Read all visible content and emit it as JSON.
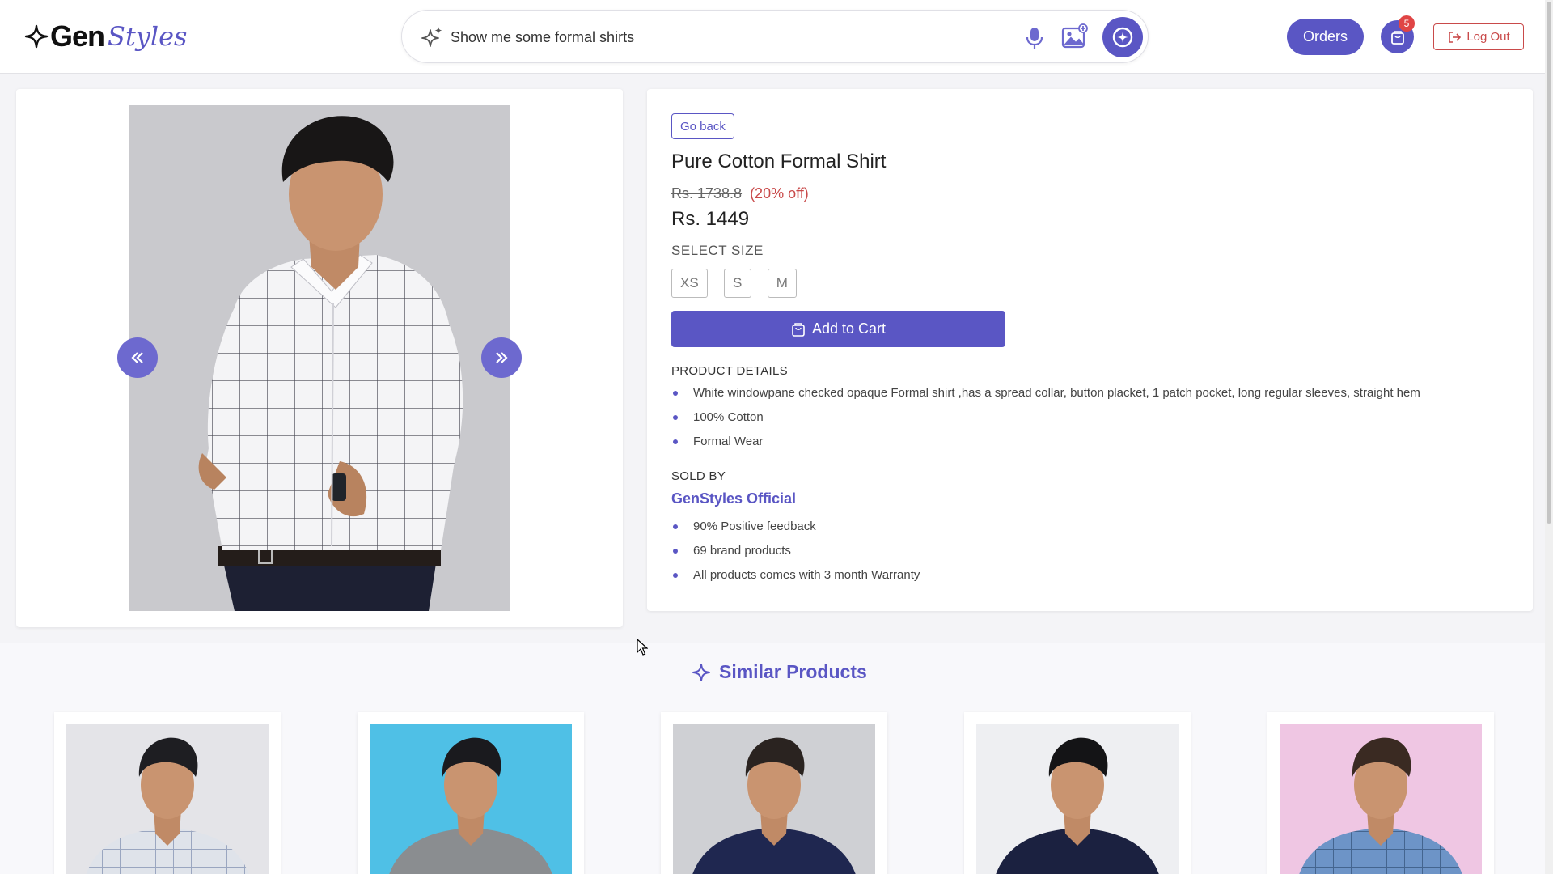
{
  "header": {
    "logo": {
      "gen": "Gen",
      "styles": "Styles"
    },
    "search": {
      "value": "Show me some formal shirts"
    },
    "orders_label": "Orders",
    "cart_count": "5",
    "logout_label": "Log Out"
  },
  "product": {
    "go_back_label": "Go back",
    "title": "Pure Cotton Formal Shirt",
    "original_price": "Rs. 1738.8",
    "discount": "(20% off)",
    "price": "Rs. 1449",
    "select_size_label": "SELECT SIZE",
    "sizes": [
      "XS",
      "S",
      "M"
    ],
    "add_to_cart_label": "Add to Cart",
    "details_label": "PRODUCT DETAILS",
    "details": [
      "White windowpane checked opaque Formal shirt ,has a spread collar, button placket, 1 patch pocket, long regular sleeves, straight hem",
      "100% Cotton",
      "Formal Wear"
    ],
    "sold_by_label": "SOLD BY",
    "seller": "GenStyles Official",
    "seller_points": [
      "90% Positive feedback",
      "69 brand products",
      "All products comes with 3 month Warranty"
    ]
  },
  "similar": {
    "title": "Similar Products",
    "items": [
      {
        "bg": "#e4e4e8",
        "shirt": "#dfe3ea",
        "check": "#9aa6c0",
        "hair": "#1e1e22"
      },
      {
        "bg": "#4fc0e6",
        "shirt": "#8a8d90",
        "check": "",
        "hair": "#1a1a1e"
      },
      {
        "bg": "#cfd0d4",
        "shirt": "#1f2750",
        "check": "",
        "hair": "#2a2320"
      },
      {
        "bg": "#eeeff2",
        "shirt": "#1b2140",
        "check": "",
        "hair": "#141416"
      },
      {
        "bg": "#efc6e3",
        "shirt": "#6d94c7",
        "check": "#44658f",
        "hair": "#3a2a22"
      }
    ]
  },
  "colors": {
    "accent": "#5a56c4",
    "danger": "#c94a4a"
  }
}
